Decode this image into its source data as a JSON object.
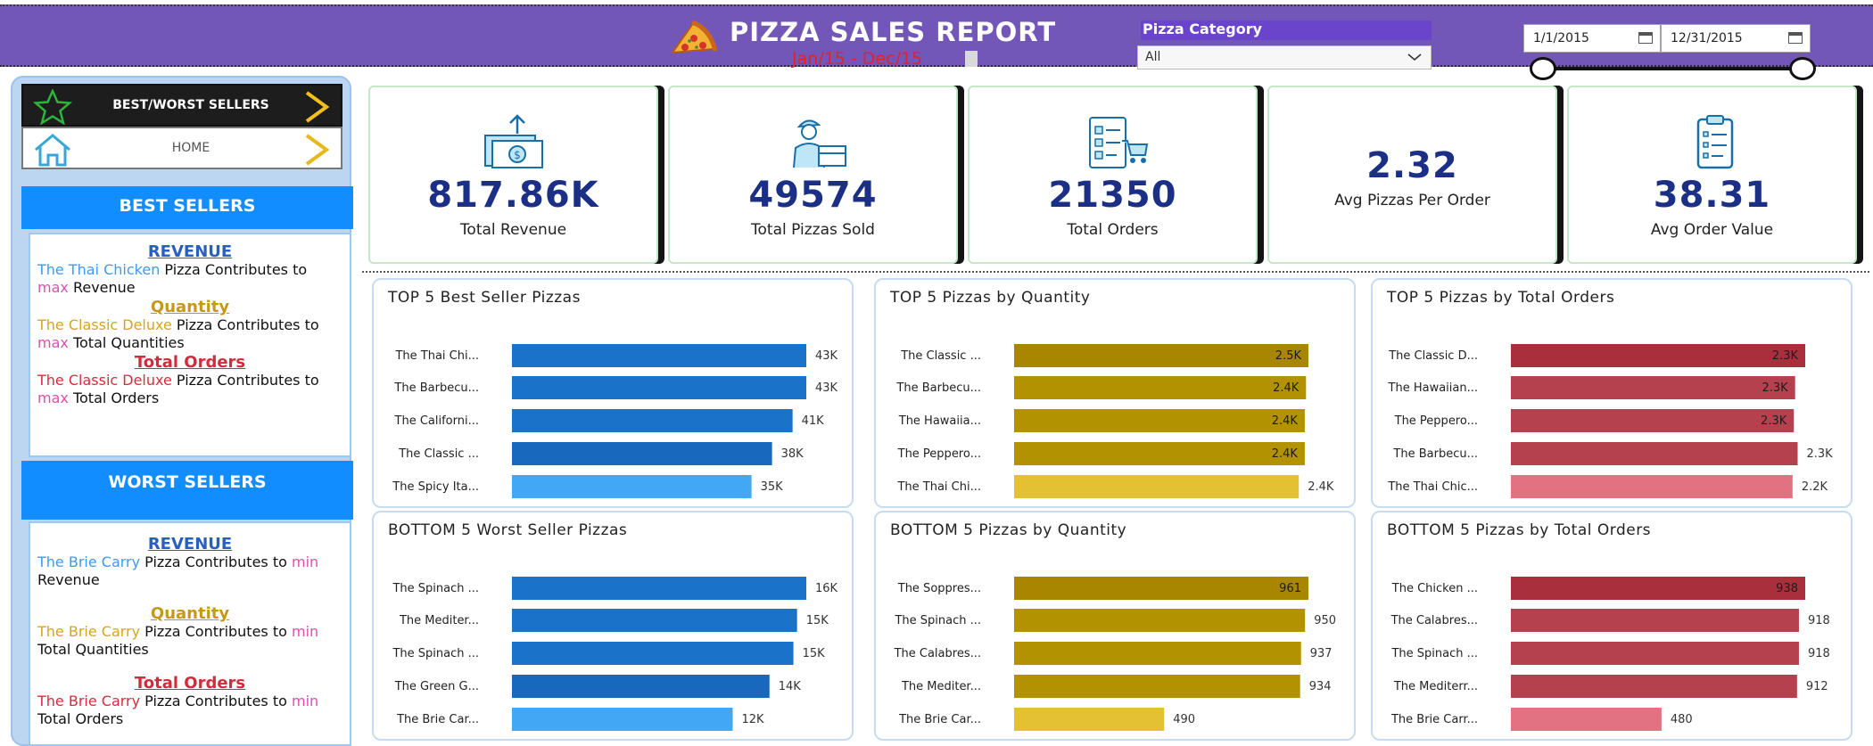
{
  "header": {
    "title": "PIZZA SALES REPORT",
    "subtitle": "Jan/15 - Dec/15",
    "category_label": "Pizza Category",
    "category_value": "All",
    "date_start": "1/1/2015",
    "date_end": "12/31/2015"
  },
  "nav": {
    "best_worst": "BEST/WORST SELLERS",
    "home": "HOME"
  },
  "best": {
    "heading": "BEST SELLERS",
    "revenue_title": "REVENUE",
    "revenue_pizza": "The Thai Chicken",
    "revenue_mid": " Pizza Contributes to ",
    "revenue_word": "max",
    "revenue_end": " Revenue",
    "qty_title": "Quantity",
    "qty_pizza": "The Classic Deluxe",
    "qty_mid": " Pizza Contributes to ",
    "qty_word": "max",
    "qty_end": " Total Quantities",
    "ord_title": "Total Orders",
    "ord_pizza": "The Classic Deluxe",
    "ord_mid": " Pizza Contributes to ",
    "ord_word": "max",
    "ord_end": " Total Orders"
  },
  "worst": {
    "heading": "WORST SELLERS",
    "revenue_title": "REVENUE",
    "revenue_pizza": "The Brie Carry",
    "revenue_mid": " Pizza Contributes to ",
    "revenue_word": "min",
    "revenue_end": " Revenue",
    "qty_title": "Quantity",
    "qty_pizza": "The Brie Carry",
    "qty_mid": "  Pizza Contributes to ",
    "qty_word": "min",
    "qty_end": " Total Quantities",
    "ord_title": "Total Orders",
    "ord_pizza": "The Brie Carry",
    "ord_mid": " Pizza Contributes to ",
    "ord_word": "min",
    "ord_end": " Total Orders"
  },
  "kpis": [
    {
      "value": "817.86K",
      "label": "Total Revenue",
      "icon": "money-icon"
    },
    {
      "value": "49574",
      "label": "Total Pizzas Sold",
      "icon": "delivery-person-icon"
    },
    {
      "value": "21350",
      "label": "Total Orders",
      "icon": "order-checklist-icon"
    },
    {
      "value": "2.32",
      "label": "Avg Pizzas Per Order",
      "icon": ""
    },
    {
      "value": "38.31",
      "label": "Avg Order Value",
      "icon": "clipboard-icon"
    }
  ],
  "colors": {
    "header": "#7257b8",
    "kpi_value": "#1b2f86",
    "blue_bar": "#1777d4",
    "gold_bar": "#b08d0a",
    "red_bar": "#b23a4a"
  },
  "chart_data": [
    {
      "type": "bar",
      "title": "TOP 5 Best Seller Pizzas",
      "palette": "blue",
      "categories": [
        "The Thai Chi...",
        "The Barbecu...",
        "The Californi...",
        "The Classic ...",
        "The Spicy Ita..."
      ],
      "values": [
        43,
        43,
        41,
        38,
        35
      ],
      "labels": [
        "43K",
        "43K",
        "41K",
        "38K",
        "35K"
      ],
      "label_inside": false
    },
    {
      "type": "bar",
      "title": "TOP 5 Pizzas by Quantity",
      "palette": "gold",
      "categories": [
        "The Classic ...",
        "The Barbecu...",
        "The Hawaiia...",
        "The Peppero...",
        "The Thai Chi..."
      ],
      "values": [
        2.45,
        2.43,
        2.42,
        2.42,
        2.37
      ],
      "labels": [
        "2.5K",
        "2.4K",
        "2.4K",
        "2.4K",
        "2.4K"
      ],
      "label_inside": [
        true,
        true,
        true,
        true,
        false
      ]
    },
    {
      "type": "bar",
      "title": "TOP 5 Pizzas by Total Orders",
      "palette": "red",
      "categories": [
        "The Classic D...",
        "The Hawaiian...",
        "The Peppero...",
        "The Barbecu...",
        "The Thai Chic..."
      ],
      "values": [
        2.33,
        2.25,
        2.24,
        2.27,
        2.23
      ],
      "labels": [
        "2.3K",
        "2.3K",
        "2.3K",
        "2.3K",
        "2.2K"
      ],
      "label_inside": [
        true,
        true,
        true,
        false,
        false
      ]
    },
    {
      "type": "bar",
      "title": "BOTTOM 5 Worst Seller Pizzas",
      "palette": "blue",
      "categories": [
        "The Spinach ...",
        "The Mediter...",
        "The Spinach ...",
        "The Green G...",
        "The Brie Car..."
      ],
      "values": [
        16,
        15.5,
        15.3,
        14,
        12
      ],
      "labels": [
        "16K",
        "15K",
        "15K",
        "14K",
        "12K"
      ],
      "label_inside": false
    },
    {
      "type": "bar",
      "title": "BOTTOM 5 Pizzas by Quantity",
      "palette": "gold",
      "categories": [
        "The Soppres...",
        "The Spinach ...",
        "The Calabres...",
        "The Mediter...",
        "The Brie Car..."
      ],
      "values": [
        961,
        950,
        937,
        934,
        490
      ],
      "labels": [
        "961",
        "950",
        "937",
        "934",
        "490"
      ],
      "label_inside": [
        true,
        false,
        false,
        false,
        false
      ]
    },
    {
      "type": "bar",
      "title": "BOTTOM 5 Pizzas by Total Orders",
      "palette": "red",
      "categories": [
        "The Chicken ...",
        "The Calabres...",
        "The Spinach ...",
        "The Mediterr...",
        "The Brie Carr..."
      ],
      "values": [
        938,
        918,
        918,
        912,
        480
      ],
      "labels": [
        "938",
        "918",
        "918",
        "912",
        "480"
      ],
      "label_inside": [
        true,
        false,
        false,
        false,
        false
      ]
    }
  ]
}
